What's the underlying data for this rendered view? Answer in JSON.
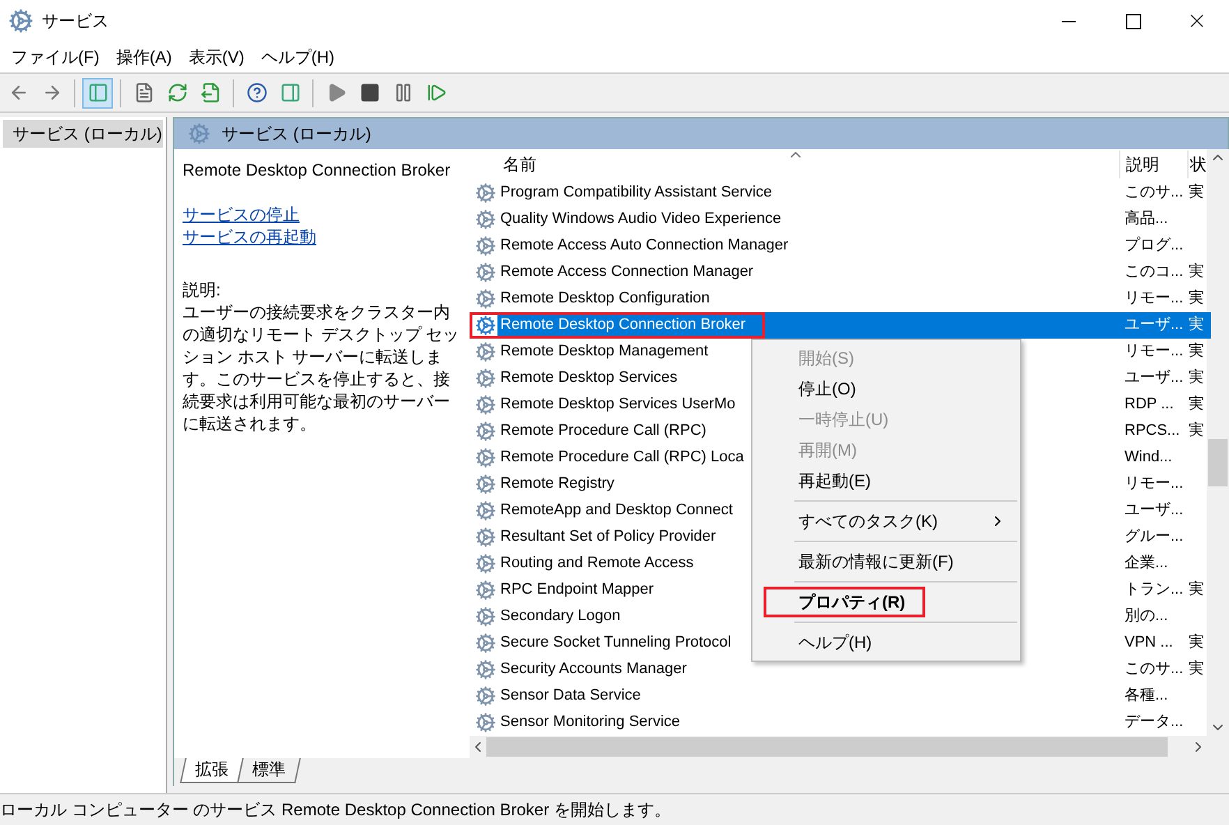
{
  "window": {
    "title": "サービス"
  },
  "menu": [
    "ファイル(F)",
    "操作(A)",
    "表示(V)",
    "ヘルプ(H)"
  ],
  "toolbar": [
    {
      "kind": "back",
      "pressed": false
    },
    {
      "kind": "forward",
      "pressed": false
    },
    {
      "kind": "sep"
    },
    {
      "kind": "tree",
      "pressed": true
    },
    {
      "kind": "sep"
    },
    {
      "kind": "properties",
      "pressed": false
    },
    {
      "kind": "refresh",
      "pressed": false
    },
    {
      "kind": "export",
      "pressed": false
    },
    {
      "kind": "sep"
    },
    {
      "kind": "help",
      "pressed": false
    },
    {
      "kind": "pane",
      "pressed": false
    },
    {
      "kind": "sep"
    },
    {
      "kind": "play",
      "pressed": false
    },
    {
      "kind": "stop",
      "pressed": false
    },
    {
      "kind": "pause",
      "pressed": false
    },
    {
      "kind": "resume",
      "pressed": false
    }
  ],
  "tree": {
    "items": [
      {
        "label": "サービス (ローカル)",
        "selected": true
      }
    ]
  },
  "pane_header": "サービス (ローカル)",
  "details": {
    "title": "Remote Desktop Connection Broker",
    "links": [
      "サービスの停止",
      "サービスの再起動"
    ],
    "description_label": "説明:",
    "description": "ユーザーの接続要求をクラスター内の適切なリモート デスクトップ セッション ホスト サーバーに転送します。このサービスを停止すると、接続要求は利用可能な最初のサーバーに転送されます。"
  },
  "table": {
    "columns": [
      "名前",
      "説明",
      "状"
    ],
    "rows": [
      {
        "name": "Program Compatibility Assistant Service",
        "description": "このサ...",
        "status": "実",
        "selected": false
      },
      {
        "name": "Quality Windows Audio Video Experience",
        "description": "高品...",
        "selected": false
      },
      {
        "name": "Remote Access Auto Connection Manager",
        "description": "プログ...",
        "selected": false
      },
      {
        "name": "Remote Access Connection Manager",
        "description": "このコ...",
        "status": "実",
        "selected": false
      },
      {
        "name": "Remote Desktop Configuration",
        "description": "リモー...",
        "status": "実",
        "selected": false
      },
      {
        "name": "Remote Desktop Connection Broker",
        "description": "ユーザ...",
        "status": "実",
        "selected": true,
        "highlighted": true
      },
      {
        "name": "Remote Desktop Management",
        "description": "リモー...",
        "status": "実",
        "selected": false
      },
      {
        "name": "Remote Desktop Services",
        "description": "ユーザ...",
        "status": "実",
        "selected": false
      },
      {
        "name": "Remote Desktop Services UserMo",
        "description": "RDP ...",
        "status": "実",
        "selected": false
      },
      {
        "name": "Remote Procedure Call (RPC)",
        "description": "RPCS...",
        "status": "実",
        "selected": false
      },
      {
        "name": "Remote Procedure Call (RPC) Loca",
        "description": "Wind...",
        "selected": false
      },
      {
        "name": "Remote Registry",
        "description": "リモー...",
        "selected": false
      },
      {
        "name": "RemoteApp and Desktop Connect",
        "description": "ユーザ...",
        "selected": false
      },
      {
        "name": "Resultant Set of Policy Provider",
        "description": "グルー...",
        "selected": false
      },
      {
        "name": "Routing and Remote Access",
        "description": "企業...",
        "selected": false
      },
      {
        "name": "RPC Endpoint Mapper",
        "description": "トラン...",
        "status": "実",
        "selected": false
      },
      {
        "name": "Secondary Logon",
        "description": "別の...",
        "selected": false
      },
      {
        "name": "Secure Socket Tunneling Protocol",
        "description": "VPN ...",
        "status": "実",
        "selected": false
      },
      {
        "name": "Security Accounts Manager",
        "description": "このサ...",
        "status": "実",
        "selected": false
      },
      {
        "name": "Sensor Data Service",
        "description": "各種...",
        "selected": false
      },
      {
        "name": "Sensor Monitoring Service",
        "description": "データ...",
        "selected": false
      }
    ]
  },
  "context_menu": [
    {
      "kind": "item",
      "label": "開始(S)",
      "disabled": true
    },
    {
      "kind": "item",
      "label": "停止(O)",
      "disabled": false
    },
    {
      "kind": "item",
      "label": "一時停止(U)",
      "disabled": true
    },
    {
      "kind": "item",
      "label": "再開(M)",
      "disabled": true
    },
    {
      "kind": "item",
      "label": "再起動(E)",
      "disabled": false
    },
    {
      "kind": "separator"
    },
    {
      "kind": "submenu",
      "label": "すべてのタスク(K)",
      "disabled": false
    },
    {
      "kind": "separator"
    },
    {
      "kind": "item",
      "label": "最新の情報に更新(F)",
      "disabled": false
    },
    {
      "kind": "separator"
    },
    {
      "kind": "item",
      "label": "プロパティ(R)",
      "disabled": false,
      "bold": true,
      "highlighted": true
    },
    {
      "kind": "separator"
    },
    {
      "kind": "item",
      "label": "ヘルプ(H)",
      "disabled": false
    }
  ],
  "view_tabs": [
    {
      "label": "拡張",
      "selected": true
    },
    {
      "label": "標準",
      "selected": false
    }
  ],
  "status_bar": "ローカル コンピューター のサービス Remote Desktop Connection Broker を開始します。"
}
